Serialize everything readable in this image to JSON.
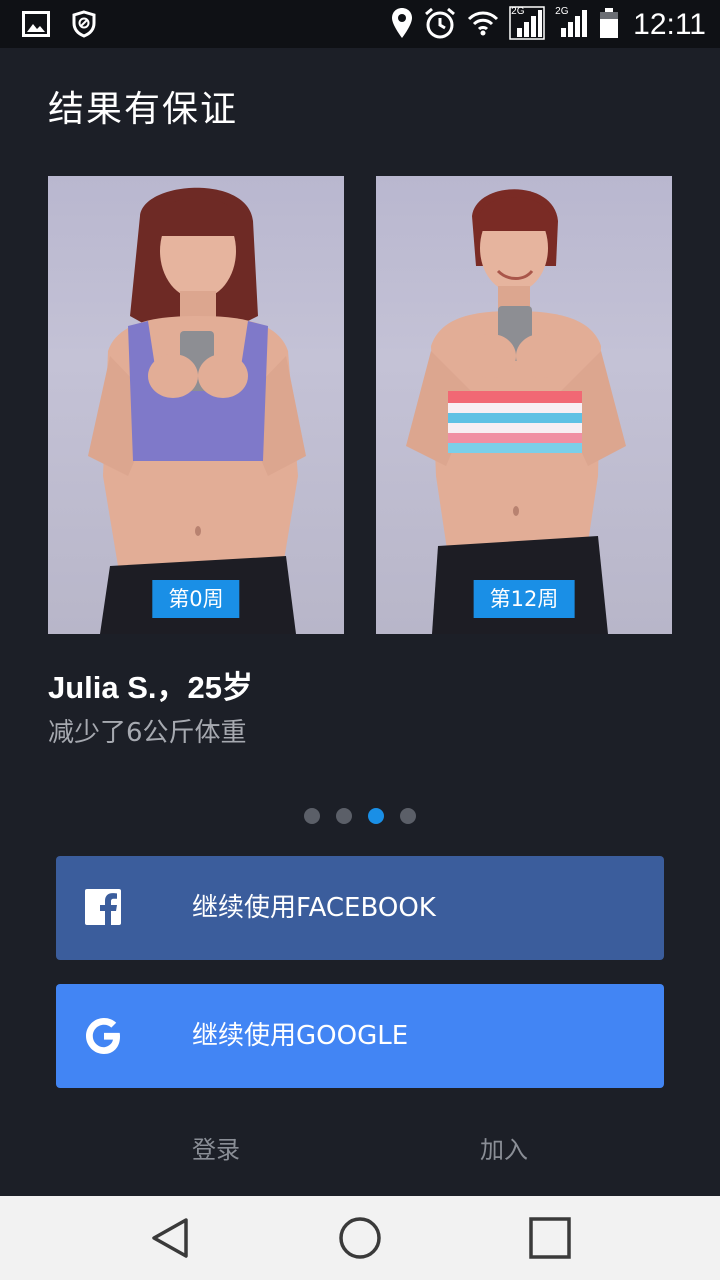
{
  "status_bar": {
    "time": "12:11",
    "signal_label_1": "2G",
    "signal_label_2": "2G",
    "icons": [
      "image-icon",
      "shield-icon",
      "location-icon",
      "alarm-icon",
      "wifi-icon",
      "signal-icon",
      "signal-icon",
      "battery-icon"
    ]
  },
  "header": {
    "title": "结果有保证"
  },
  "slides": {
    "before_label": "第0周",
    "after_label": "第12周"
  },
  "testimonial": {
    "name": "Julia S.，25岁",
    "result": "减少了6公斤体重"
  },
  "pager": {
    "count": 4,
    "active_index": 2
  },
  "buttons": {
    "facebook_label": "继续使用FACEBOOK",
    "google_label": "继续使用GOOGLE"
  },
  "footer_links": {
    "login": "登录",
    "join": "加入"
  },
  "colors": {
    "background": "#1c1f27",
    "accent": "#1a8fe6",
    "facebook": "#3b5d9c",
    "google": "#4285f4"
  }
}
